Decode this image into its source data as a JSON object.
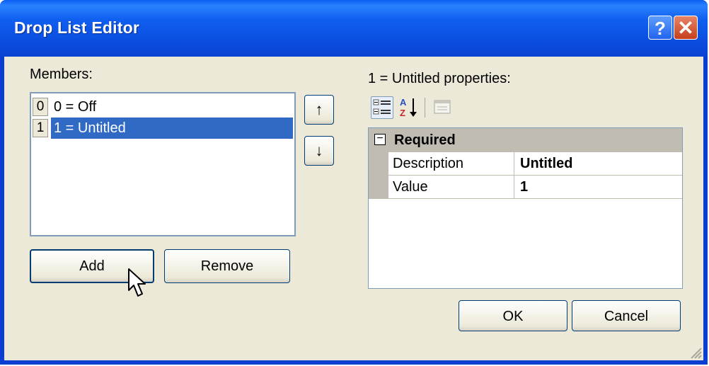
{
  "window": {
    "title": "Drop List Editor"
  },
  "members": {
    "label": "Members:",
    "items": [
      {
        "index": "0",
        "text": "0 = Off",
        "selected": false
      },
      {
        "index": "1",
        "text": "1 = Untitled",
        "selected": true
      }
    ]
  },
  "buttons": {
    "add": "Add",
    "remove": "Remove",
    "ok": "OK",
    "cancel": "Cancel",
    "up": "↑",
    "down": "↓"
  },
  "properties": {
    "label": "1 = Untitled properties:",
    "category": "Required",
    "rows": [
      {
        "name": "Description",
        "value": "Untitled"
      },
      {
        "name": "Value",
        "value": "1"
      }
    ]
  },
  "icons": {
    "help": "help-icon",
    "close": "close-icon",
    "categorized": "categorized-icon",
    "alphabetical": "alphabetical-sort-icon",
    "property_pages": "property-pages-icon"
  },
  "colors": {
    "titlebar": "#0a5ff3",
    "selection": "#316ac5",
    "dialog": "#ece9d8"
  }
}
